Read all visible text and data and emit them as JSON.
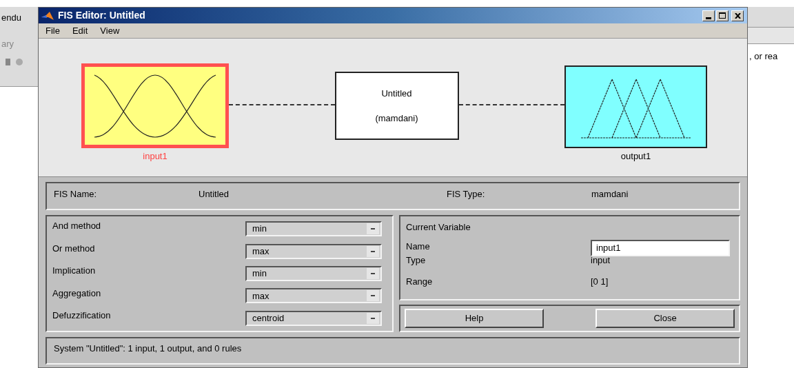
{
  "background_left": {
    "texts": [
      "endu",
      "ary"
    ]
  },
  "background_right": {
    "text": ", or rea"
  },
  "window": {
    "title": "FIS Editor: Untitled"
  },
  "menu": [
    "File",
    "Edit",
    "View"
  ],
  "diagram": {
    "variables": [
      {
        "kind": "input",
        "label": "input1",
        "selected": true
      },
      {
        "kind": "output",
        "label": "output1",
        "selected": false
      }
    ],
    "system": {
      "name": "Untitled",
      "type": "(mamdani)"
    }
  },
  "info": {
    "fis_name_label": "FIS Name:",
    "fis_name": "Untitled",
    "fis_type_label": "FIS Type:",
    "fis_type": "mamdani"
  },
  "methods": [
    {
      "label": "And method",
      "value": "min"
    },
    {
      "label": "Or method",
      "value": "max"
    },
    {
      "label": "Implication",
      "value": "min"
    },
    {
      "label": "Aggregation",
      "value": "max"
    },
    {
      "label": "Defuzzification",
      "value": "centroid"
    }
  ],
  "current_variable": {
    "title": "Current Variable",
    "name_label": "Name",
    "name_value": "input1",
    "type_label": "Type",
    "type_value": "input",
    "range_label": "Range",
    "range_value": "[0 1]"
  },
  "buttons": [
    "Help",
    "Close"
  ],
  "status": "System \"Untitled\": 1 input, 1 output, and 0 rules"
}
